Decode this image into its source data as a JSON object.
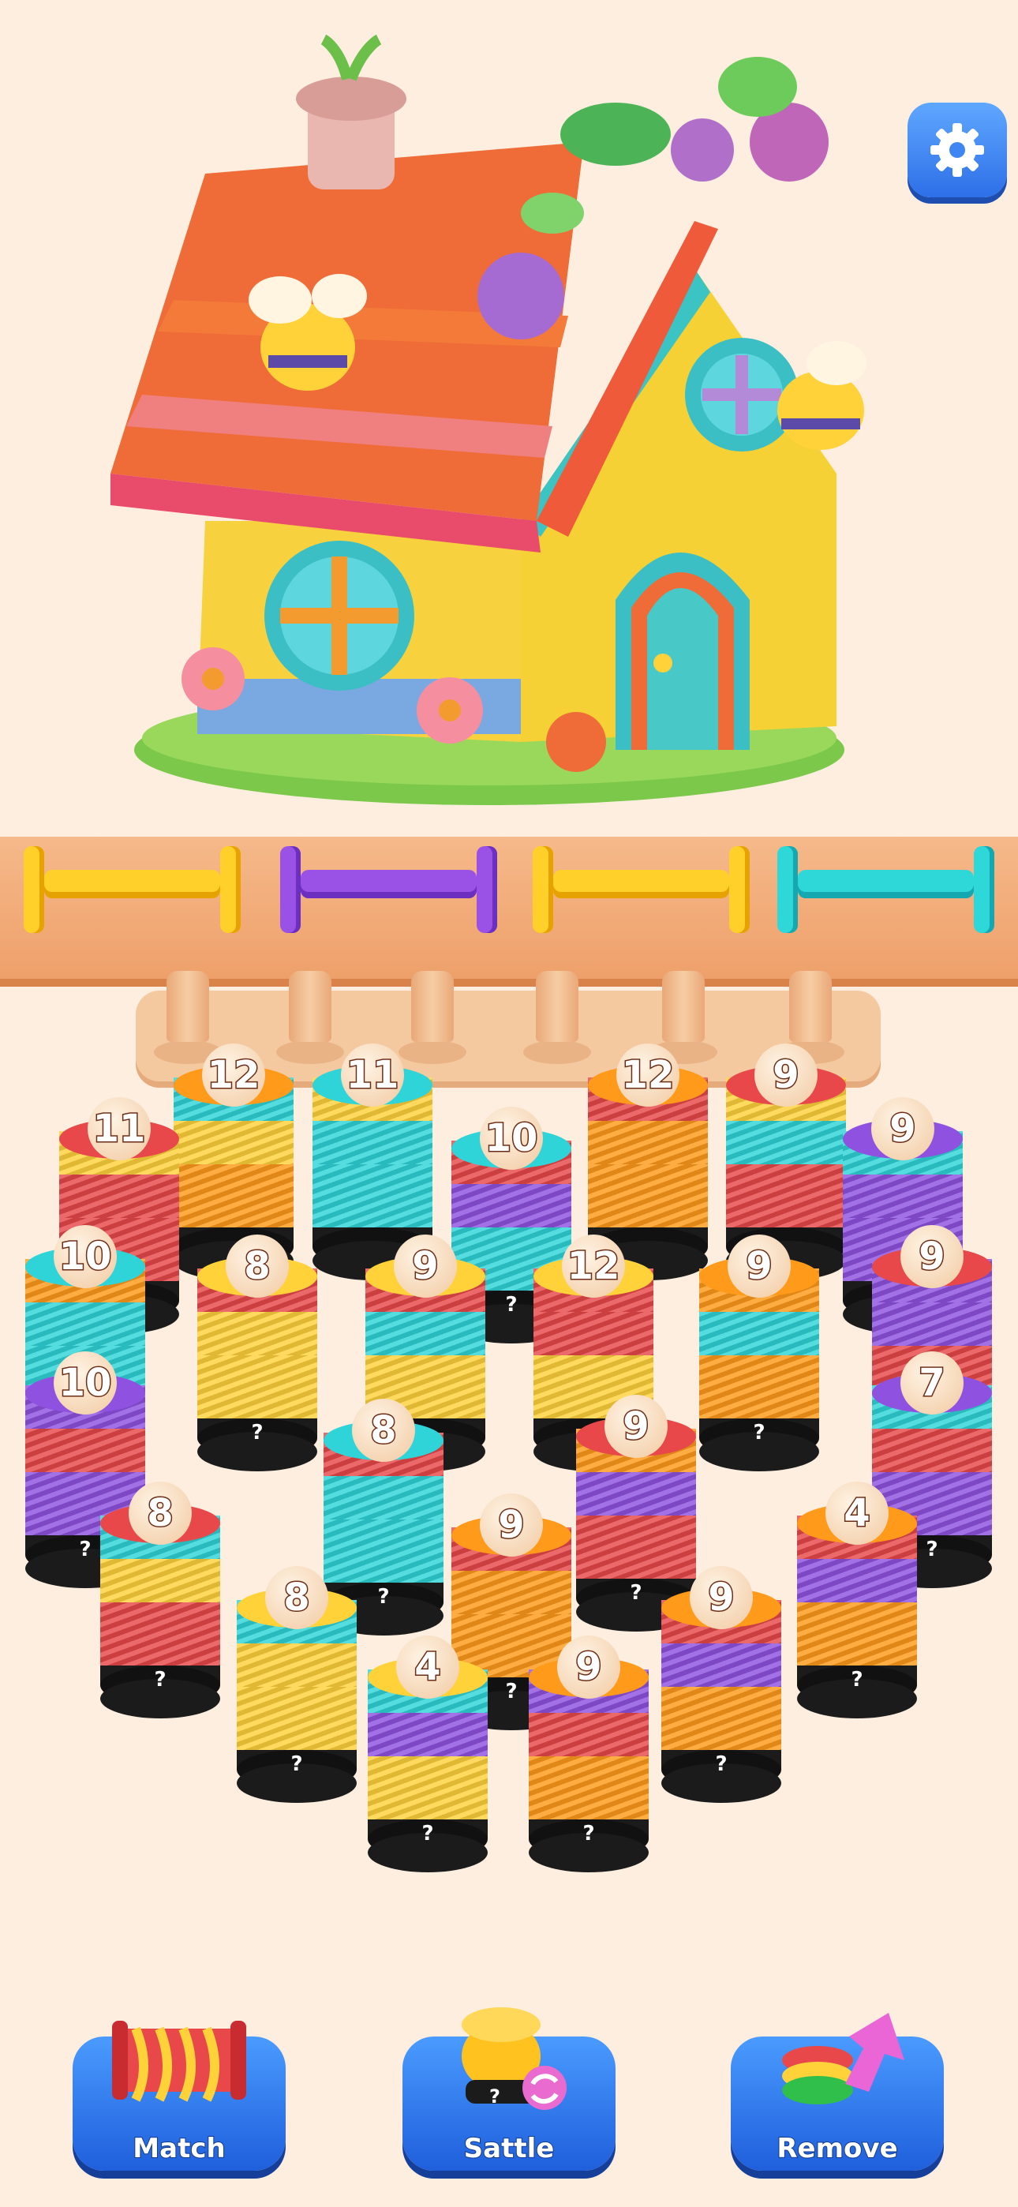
{
  "colors": {
    "red": "#e8484a",
    "orange": "#ff9a1a",
    "yellow": "#ffd23a",
    "cyan": "#2fd4d8",
    "purple": "#8f52e0",
    "black": "#1b1b1b",
    "background": "#fdeee0"
  },
  "shelf_slots": [
    {
      "color": "#ffd02a",
      "shade": "#e6a200"
    },
    {
      "color": "#9a52e6",
      "shade": "#6d2fc0"
    },
    {
      "color": "#ffd02a",
      "shade": "#e6a200"
    },
    {
      "color": "#2fd8d8",
      "shade": "#16a8b0"
    }
  ],
  "peg_count": 6,
  "stacks": [
    {
      "count": "12",
      "hidden": "",
      "layers": [
        "#ff9a1a",
        "#ffd23a",
        "#2fd4d8"
      ]
    },
    {
      "count": "11",
      "hidden": "",
      "layers": [
        "#2fd4d8",
        "#2fd4d8",
        "#ffd23a"
      ]
    },
    {
      "count": "12",
      "hidden": "",
      "layers": [
        "#ff9a1a",
        "#ff9a1a",
        "#e8484a"
      ]
    },
    {
      "count": "9",
      "hidden": "",
      "layers": [
        "#e8484a",
        "#2fd4d8",
        "#ffd23a"
      ]
    },
    {
      "count": "11",
      "hidden": "",
      "layers": [
        "#e8484a",
        "#e8484a",
        "#ffd23a"
      ]
    },
    {
      "count": "10",
      "hidden": "?",
      "layers": [
        "#2fd4d8",
        "#8f52e0",
        "#e8484a"
      ]
    },
    {
      "count": "9",
      "hidden": "",
      "layers": [
        "#8f52e0",
        "#8f52e0",
        "#2fd4d8"
      ]
    },
    {
      "count": "10",
      "hidden": "",
      "layers": [
        "#2fd4d8",
        "#2fd4d8",
        "#ff9a1a"
      ]
    },
    {
      "count": "8",
      "hidden": "?",
      "layers": [
        "#ffd23a",
        "#ffd23a",
        "#e8484a"
      ]
    },
    {
      "count": "9",
      "hidden": "",
      "layers": [
        "#ffd23a",
        "#2fd4d8",
        "#e8484a"
      ]
    },
    {
      "count": "12",
      "hidden": "",
      "layers": [
        "#ffd23a",
        "#e8484a",
        "#e8484a"
      ]
    },
    {
      "count": "9",
      "hidden": "?",
      "layers": [
        "#ff9a1a",
        "#2fd4d8",
        "#ff9a1a"
      ]
    },
    {
      "count": "9",
      "hidden": "",
      "layers": [
        "#e8484a",
        "#8f52e0",
        "#8f52e0"
      ]
    },
    {
      "count": "10",
      "hidden": "?",
      "layers": [
        "#8f52e0",
        "#e8484a",
        "#8f52e0"
      ]
    },
    {
      "count": "8",
      "hidden": "?",
      "layers": [
        "#2fd4d8",
        "#2fd4d8",
        "#e8484a"
      ]
    },
    {
      "count": "9",
      "hidden": "?",
      "layers": [
        "#e8484a",
        "#8f52e0",
        "#ff9a1a"
      ]
    },
    {
      "count": "7",
      "hidden": "?",
      "layers": [
        "#8f52e0",
        "#e8484a",
        "#2fd4d8"
      ]
    },
    {
      "count": "8",
      "hidden": "?",
      "layers": [
        "#e8484a",
        "#ffd23a",
        "#2fd4d8"
      ]
    },
    {
      "count": "9",
      "hidden": "?",
      "layers": [
        "#ff9a1a",
        "#ff9a1a",
        "#e8484a"
      ]
    },
    {
      "count": "4",
      "hidden": "?",
      "layers": [
        "#ff9a1a",
        "#8f52e0",
        "#e8484a"
      ]
    },
    {
      "count": "8",
      "hidden": "?",
      "layers": [
        "#ffd23a",
        "#ffd23a",
        "#2fd4d8"
      ]
    },
    {
      "count": "9",
      "hidden": "?",
      "layers": [
        "#ff9a1a",
        "#8f52e0",
        "#e8484a"
      ]
    },
    {
      "count": "4",
      "hidden": "?",
      "layers": [
        "#ffd23a",
        "#8f52e0",
        "#2fd4d8"
      ]
    },
    {
      "count": "9",
      "hidden": "?",
      "layers": [
        "#ff9a1a",
        "#e8484a",
        "#8f52e0"
      ]
    }
  ],
  "buttons": {
    "match": "Match",
    "sattle": "Sattle",
    "remove": "Remove",
    "sattle_badge": "?"
  }
}
